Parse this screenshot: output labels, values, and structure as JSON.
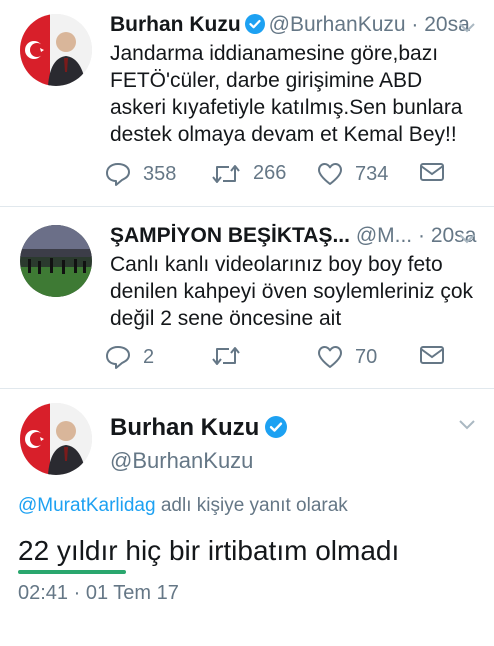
{
  "tweets": [
    {
      "name": "Burhan Kuzu",
      "handle": "@BurhanKuzu",
      "separator": "·",
      "time": "20sa",
      "text": "Jandarma iddianamesine göre,bazı FETÖ'cüler, darbe girişimine ABD askeri kıyafetiyle katılmış.Sen bunlara destek olmaya devam et Kemal Bey!!",
      "replies": "358",
      "retweets": "266",
      "likes": "734",
      "verified": true
    },
    {
      "name": "ŞAMPİYON BEŞİKTAŞ...",
      "handle": "@M...",
      "separator": "·",
      "time": "20sa",
      "text": "Canlı kanlı videolarınız boy boy feto denilen kahpeyi öven soylemleriniz çok değil 2 sene öncesine ait",
      "replies": "2",
      "retweets": "",
      "likes": "70",
      "verified": false
    }
  ],
  "detail": {
    "name": "Burhan Kuzu",
    "handle": "@BurhanKuzu",
    "reply_mention": "@MuratKarlidag",
    "reply_suffix": " adlı kişiye yanıt olarak",
    "text": "22 yıldır hiç bir irtibatım olmadı",
    "timestamp": "02:41 · 01 Tem 17"
  },
  "icons": {
    "reply": "reply-icon",
    "retweet": "retweet-icon",
    "like": "heart-icon",
    "dm": "envelope-icon",
    "verified": "verified-badge-icon",
    "more": "chevron-down-icon"
  },
  "colors": {
    "accent": "#1da1f2",
    "muted": "#657786",
    "text": "#14171a",
    "highlight": "#2aa76e"
  }
}
